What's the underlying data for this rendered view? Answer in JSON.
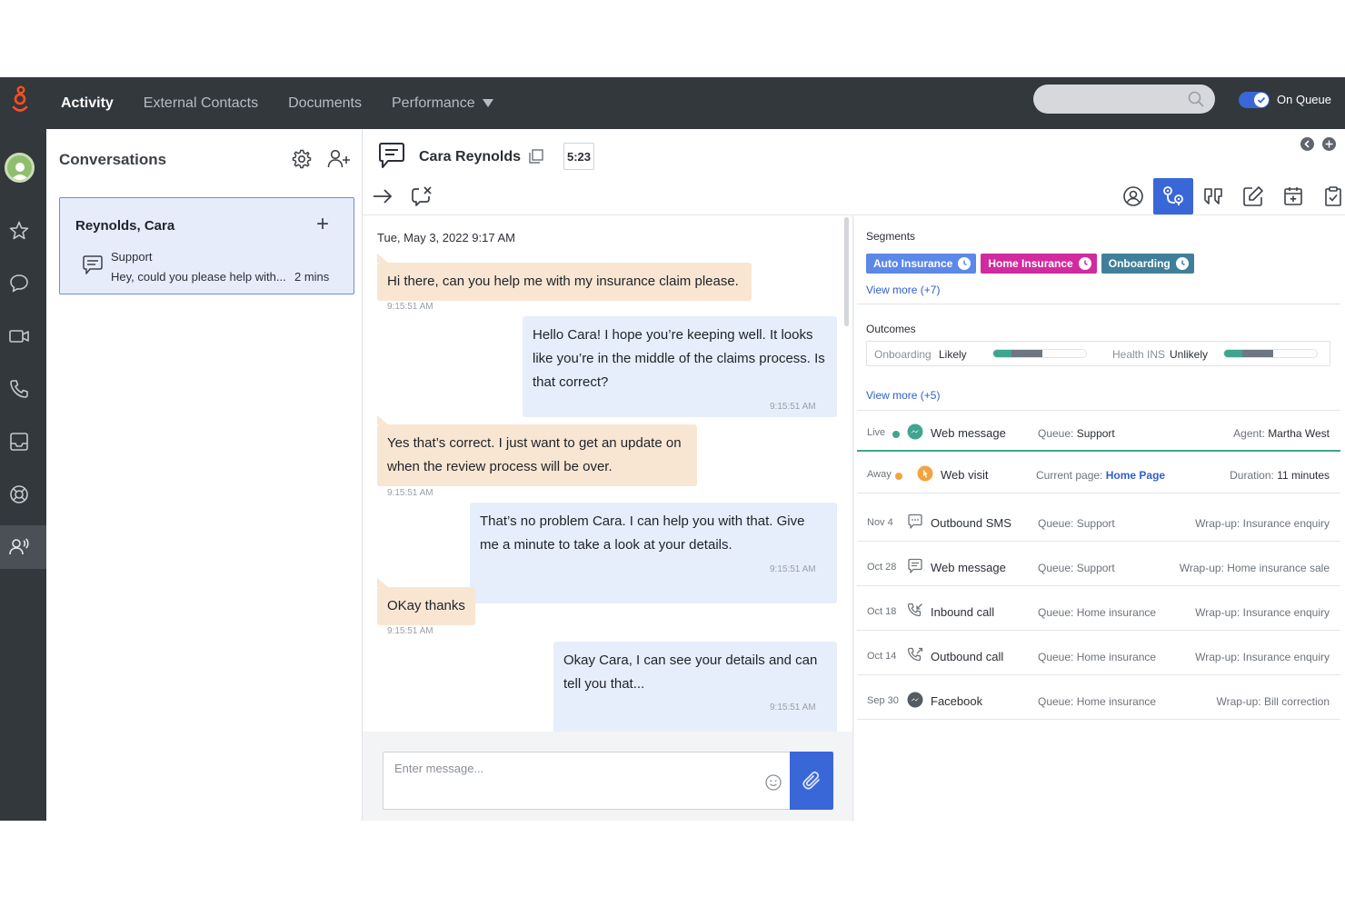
{
  "colors": {
    "accent": "#3a67d8",
    "topbar": "#33383d",
    "inbound_bubble": "#f8e6d3",
    "outbound_bubble": "#e6eefb",
    "live": "#3fa58e",
    "away": "#f2a444"
  },
  "nav": {
    "items": [
      "Activity",
      "External Contacts",
      "Documents",
      "Performance"
    ]
  },
  "status": {
    "queue_label": "On Queue"
  },
  "conversations": {
    "title": "Conversations",
    "card": {
      "name": "Reynolds, Cara",
      "queue": "Support",
      "preview": "Hey, could you please help with...",
      "age": "2 mins"
    }
  },
  "chat": {
    "contact": "Cara Reynolds",
    "timer": "5:23",
    "date": "Tue, May 3, 2022 9:17 AM",
    "messages": [
      {
        "dir": "in",
        "text": "Hi there, can you help me with my insurance claim please.",
        "time": "9:15:51 AM"
      },
      {
        "dir": "out",
        "text": "Hello Cara! I hope you’re keeping well. It looks like you’re in the middle of the claims process. Is that correct?",
        "time": "9:15:51 AM"
      },
      {
        "dir": "in",
        "text": "Yes that’s correct. I just want to get an update on when the review process will be over.",
        "time": "9:15:51 AM"
      },
      {
        "dir": "out",
        "text": "That’s no problem Cara. I can help you with that. Give me a minute to take a look at your details.",
        "time": "9:15:51 AM"
      },
      {
        "dir": "in",
        "text": "OKay thanks",
        "time": "9:15:51 AM"
      },
      {
        "dir": "out",
        "text": "Okay Cara, I can see your details and can tell you that...",
        "time": "9:15:51 AM"
      }
    ],
    "composer_placeholder": "Enter message..."
  },
  "segments": {
    "label": "Segments",
    "tags": [
      "Auto Insurance",
      "Home Insurance",
      "Onboarding"
    ],
    "view_more": "View more (+7)"
  },
  "outcomes": {
    "label": "Outcomes",
    "items": [
      {
        "name": "Onboarding",
        "value": "Likely",
        "level1": 0.2,
        "level2": 0.33
      },
      {
        "name": "Health INS",
        "value": "Unlikely",
        "level1": 0.2,
        "level2": 0.33
      }
    ],
    "view_more": "View more (+5)"
  },
  "journey": [
    {
      "date": "Live",
      "channel": "Web message",
      "queue_key": "Queue:",
      "queue_val": "Support",
      "wrap_key": "Agent:",
      "wrap_val": "Martha West"
    },
    {
      "date": "Away",
      "channel": "Web visit",
      "queue_key": "Current page:",
      "queue_val": "Home Page",
      "wrap_key": "Duration:",
      "wrap_val": "11 minutes"
    },
    {
      "date": "Nov 4",
      "channel": "Outbound SMS",
      "queue_key": "Queue:",
      "queue_val": "Support",
      "wrap_key": "Wrap-up:",
      "wrap_val": "Insurance enquiry"
    },
    {
      "date": "Oct 28",
      "channel": "Web message",
      "queue_key": "Queue:",
      "queue_val": "Support",
      "wrap_key": "Wrap-up:",
      "wrap_val": "Home insurance sale"
    },
    {
      "date": "Oct 18",
      "channel": "Inbound call",
      "queue_key": "Queue:",
      "queue_val": "Home insurance",
      "wrap_key": "Wrap-up:",
      "wrap_val": "Insurance enquiry"
    },
    {
      "date": "Oct 14",
      "channel": "Outbound call",
      "queue_key": "Queue:",
      "queue_val": "Home insurance",
      "wrap_key": "Wrap-up:",
      "wrap_val": "Insurance enquiry"
    },
    {
      "date": "Sep 30",
      "channel": "Facebook",
      "queue_key": "Queue:",
      "queue_val": "Home insurance",
      "wrap_key": "Wrap-up:",
      "wrap_val": "Bill correction"
    }
  ]
}
